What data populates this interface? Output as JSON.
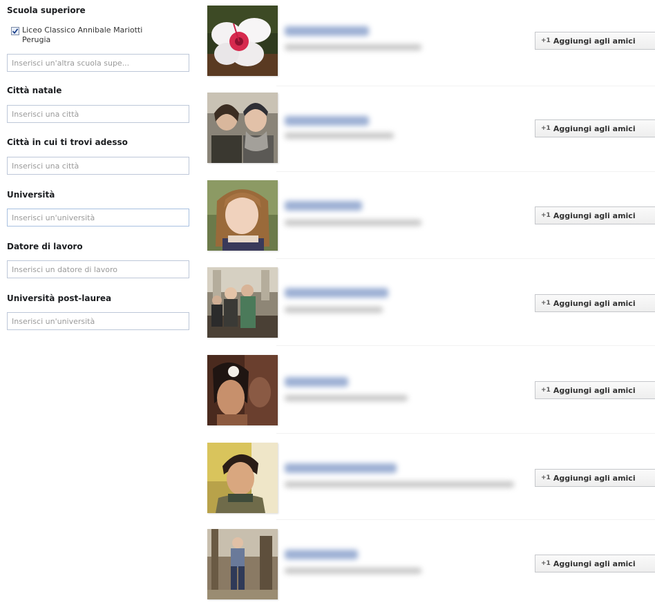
{
  "sidebar": {
    "high_school": {
      "label": "Scuola superiore",
      "checked_school": "Liceo Classico Annibale Mariotti Perugia",
      "add_placeholder": "Inserisci un'altra scuola supe..."
    },
    "hometown": {
      "label": "Città natale",
      "placeholder": "Inserisci una città"
    },
    "current_city": {
      "label": "Città in cui ti trovi adesso",
      "placeholder": "Inserisci una città"
    },
    "university": {
      "label": "Università",
      "placeholder": "Inserisci un'università"
    },
    "employer": {
      "label": "Datore di lavoro",
      "placeholder": "Inserisci un datore di lavoro"
    },
    "grad_school": {
      "label": "Università post-laurea",
      "placeholder": "Inserisci un'università"
    }
  },
  "suggestions": {
    "add_label": "Aggiungi agli amici",
    "plus_icon": "+1",
    "photos": [
      "hibiscus-flower",
      "two-women-selfie",
      "woman-portrait",
      "group-photo",
      "woman-with-flower",
      "young-man-portrait",
      "person-outdoors"
    ]
  }
}
